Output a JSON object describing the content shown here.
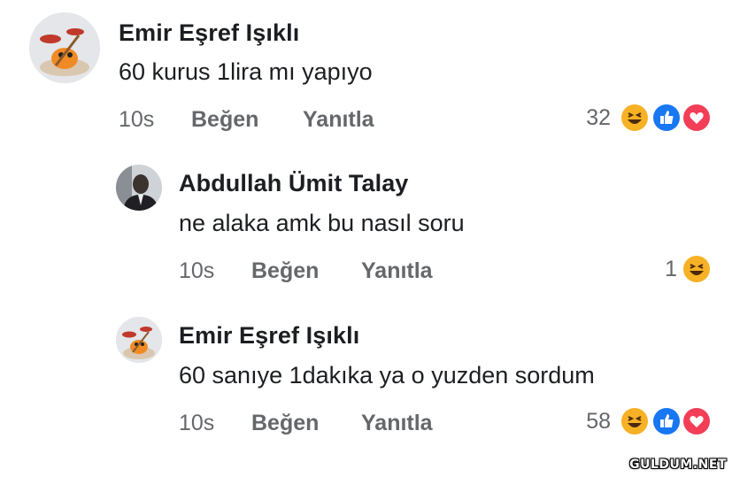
{
  "comments": [
    {
      "author": "Emir Eşref Işıklı",
      "text": "60 kurus 1lira mı yapıyo",
      "time": "10s",
      "like_label": "Beğen",
      "reply_label": "Yanıtla",
      "reaction_count": "32",
      "reactions": [
        "haha-icon",
        "like-icon",
        "love-icon"
      ]
    },
    {
      "author": "Abdullah Ümit Talay",
      "text": "ne alaka amk bu nasıl soru",
      "time": "10s",
      "like_label": "Beğen",
      "reply_label": "Yanıtla",
      "reaction_count": "1",
      "reactions": [
        "haha-icon"
      ]
    },
    {
      "author": "Emir Eşref Işıklı",
      "text": "60 sanıye 1dakıka ya o yuzden sordum",
      "time": "10s",
      "like_label": "Beğen",
      "reply_label": "Yanıtla",
      "reaction_count": "58",
      "reactions": [
        "haha-icon",
        "like-icon",
        "love-icon"
      ]
    }
  ],
  "watermark": "GULDUM.NET",
  "colors": {
    "name": "#1c1e21",
    "meta": "#65676b",
    "like_blue": "#1877f2",
    "love_red": "#f33e58",
    "haha_yellow": "#f7b125"
  }
}
